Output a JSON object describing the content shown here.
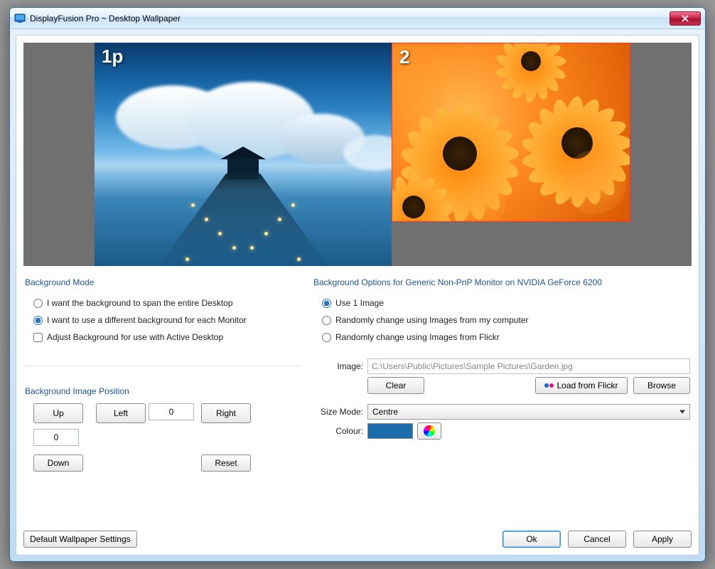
{
  "window": {
    "title": "DisplayFusion Pro ~ Desktop Wallpaper"
  },
  "preview": {
    "monitor1_label": "1p",
    "monitor2_label": "2"
  },
  "background_mode": {
    "group_label": "Background Mode",
    "span_label": "I want the background to span the entire Desktop",
    "per_monitor_label": "I want to use a different background for each Monitor",
    "active_desktop_label": "Adjust Background for use with Active Desktop",
    "selected": "per_monitor",
    "active_desktop_checked": false
  },
  "position": {
    "group_label": "Background Image Position",
    "up_label": "Up",
    "down_label": "Down",
    "left_label": "Left",
    "right_label": "Right",
    "reset_label": "Reset",
    "x_value": "0",
    "y_value": "0"
  },
  "options": {
    "group_label": "Background Options for Generic Non-PnP Monitor on NVIDIA GeForce 6200",
    "use1_label": "Use 1 Image",
    "random_computer_label": "Randomly change using Images from my computer",
    "random_flickr_label": "Randomly change using Images from Flickr",
    "selected": "use1",
    "image_label": "Image:",
    "image_path": "C:\\Users\\Public\\Pictures\\Sample Pictures\\Garden.jpg",
    "clear_label": "Clear",
    "load_flickr_label": "Load from Flickr",
    "browse_label": "Browse",
    "size_mode_label": "Size Mode:",
    "size_mode_value": "Centre",
    "colour_label": "Colour:",
    "colour_value": "#1a6da8"
  },
  "footer": {
    "default_label": "Default Wallpaper Settings",
    "ok_label": "Ok",
    "cancel_label": "Cancel",
    "apply_label": "Apply"
  }
}
